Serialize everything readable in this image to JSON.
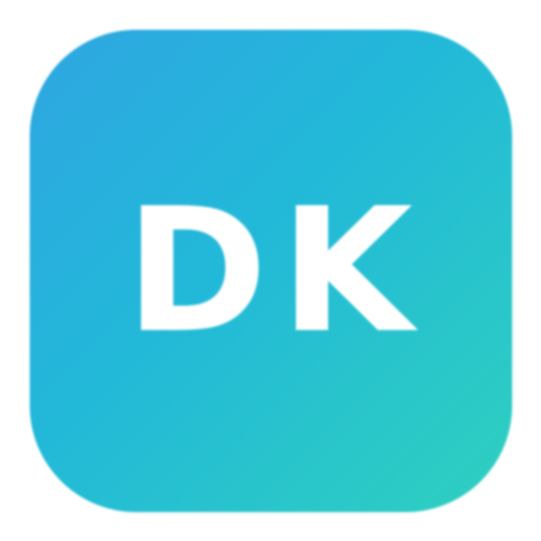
{
  "app_icon": {
    "monogram": "DK",
    "icon_name": "app-monogram-icon",
    "colors": {
      "gradient_start": "#2ea6e2",
      "gradient_mid": "#22b9d8",
      "gradient_end": "#2fd0bf",
      "text": "#ffffff",
      "background": "#ffffff"
    }
  }
}
